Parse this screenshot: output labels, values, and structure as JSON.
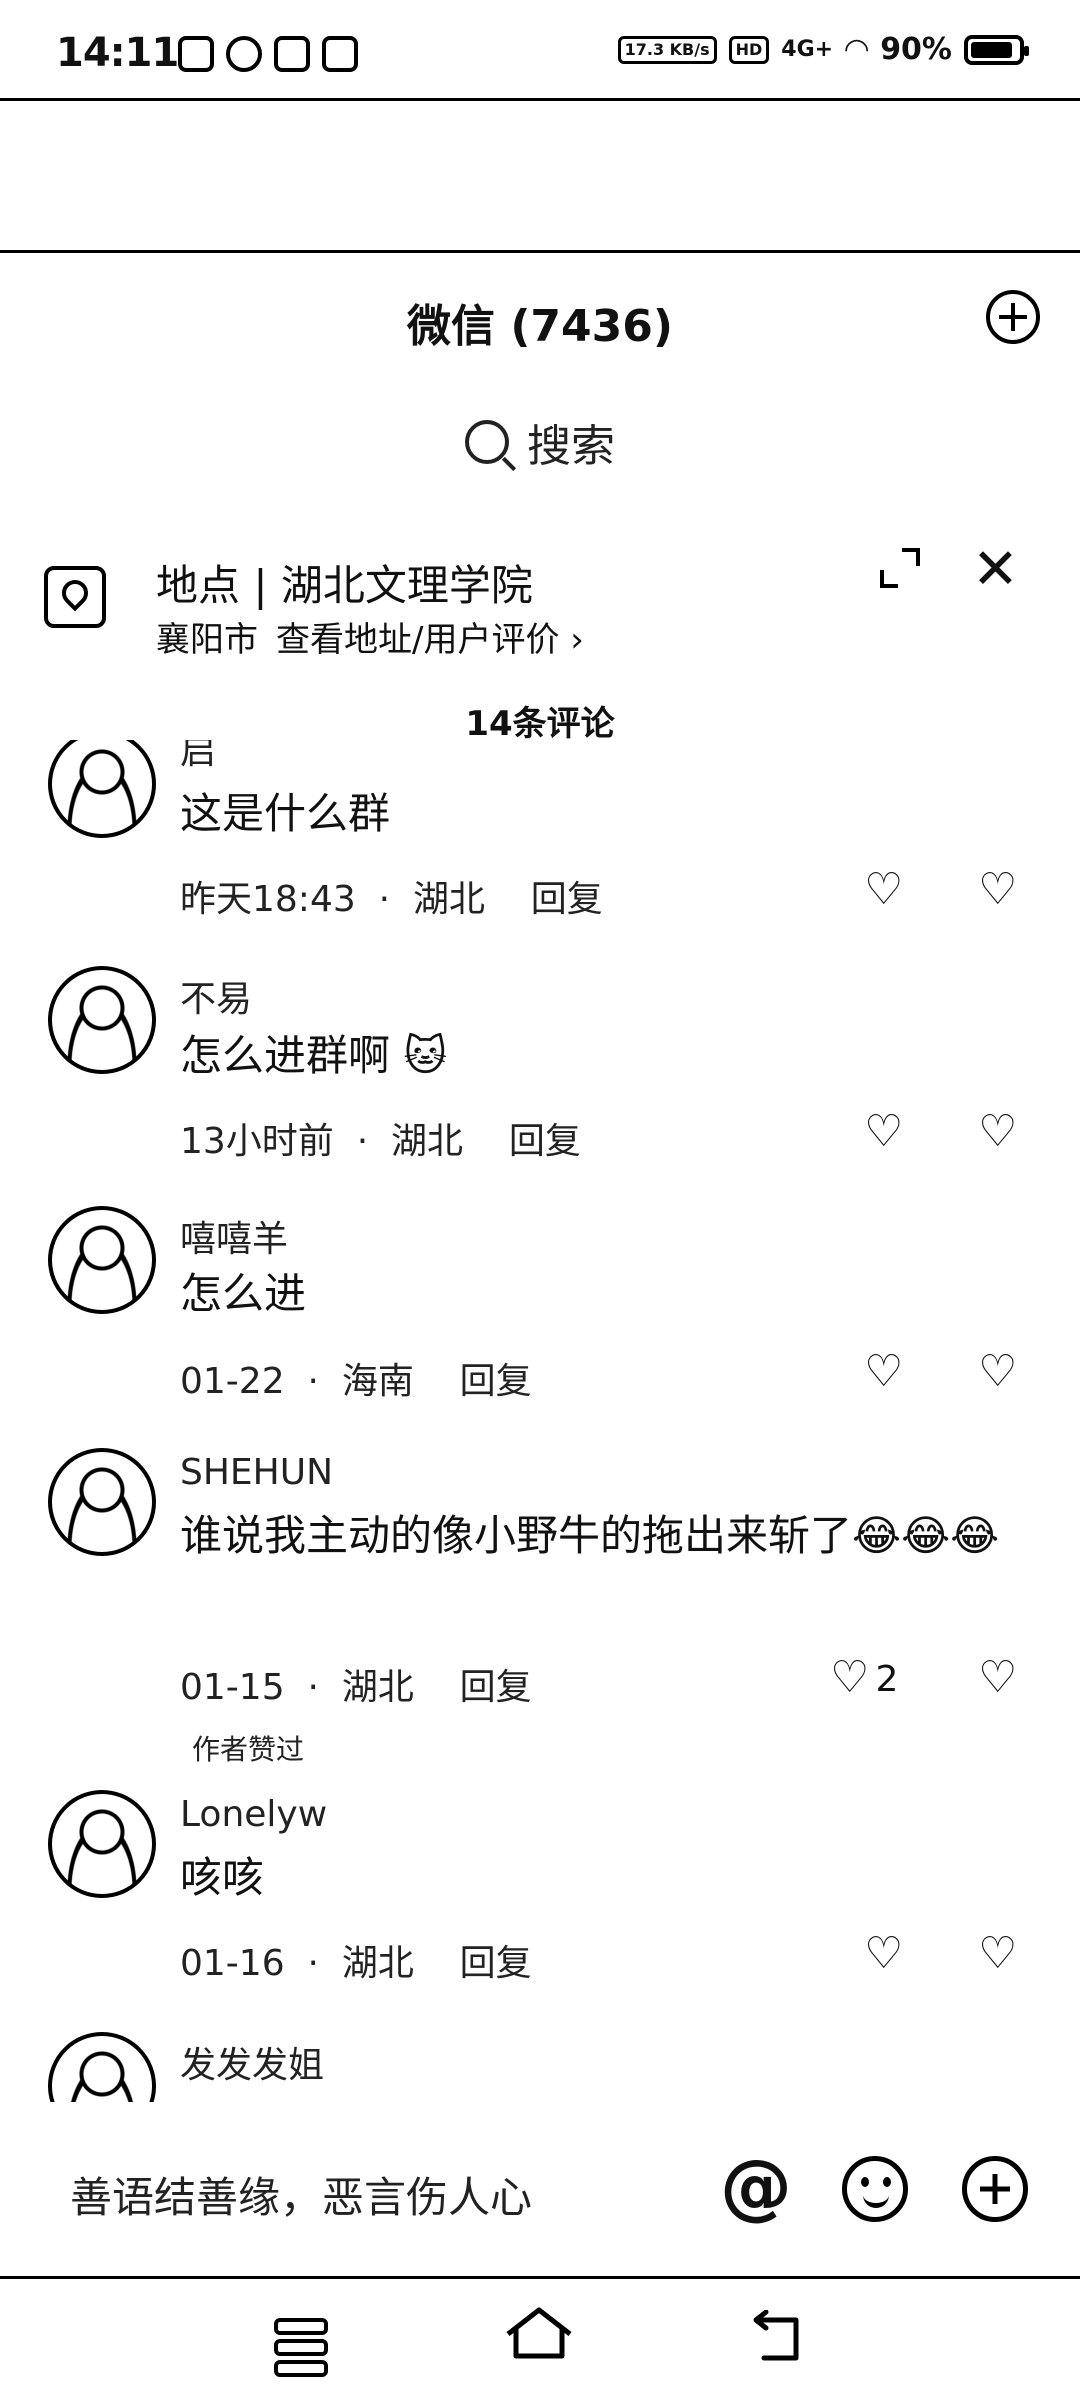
{
  "status_bar": {
    "time": "14:11",
    "net_speed": "17.3 KB/s",
    "hd": "HD",
    "signal": "4G+",
    "battery": "90%",
    "battery_level": 0.9,
    "left_icons": [
      "tiktok-icon",
      "chat-icon",
      "mail-icon",
      "app-icon"
    ]
  },
  "header": {
    "title": "微信 (7436)",
    "search_label": "搜索"
  },
  "location": {
    "title": "地点 | 湖北文理学院",
    "city": "襄阳市",
    "link": "查看地址/用户评价 ›"
  },
  "comments_header": "14条评论",
  "comments": [
    {
      "name": "启",
      "text": "这是什么群",
      "time": "昨天18:43",
      "region": "湖北",
      "reply": "回复",
      "likes": "",
      "badge": ""
    },
    {
      "name": "不易",
      "text": "怎么进群啊 🐱",
      "time": "13小时前",
      "region": "湖北",
      "reply": "回复",
      "likes": "",
      "badge": ""
    },
    {
      "name": "嘻嘻羊",
      "text": "怎么进",
      "time": "01-22",
      "region": "海南",
      "reply": "回复",
      "likes": "",
      "badge": ""
    },
    {
      "name": "SHEHUN",
      "text": "谁说我主动的像小野牛的拖出来斩了😂😂😂",
      "time": "01-15",
      "region": "湖北",
      "reply": "回复",
      "likes": "2",
      "badge": "作者赞过"
    },
    {
      "name": "Lonelyw",
      "text": "咳咳",
      "time": "01-16",
      "region": "湖北",
      "reply": "回复",
      "likes": "",
      "badge": ""
    },
    {
      "name": "发发发姐",
      "text": "",
      "time": "",
      "region": "",
      "reply": "",
      "likes": "",
      "badge": ""
    }
  ],
  "input": {
    "placeholder": "善语结善缘，恶言伤人心",
    "at": "@"
  }
}
